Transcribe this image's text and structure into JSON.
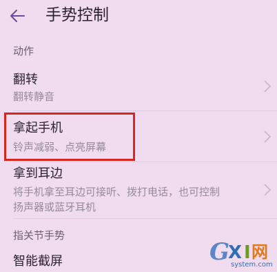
{
  "header": {
    "title": "手势控制",
    "back_icon": "back-arrow-icon"
  },
  "sections": [
    {
      "header": "动作"
    },
    {
      "header": "指关节手势"
    }
  ],
  "items": [
    {
      "title": "翻转",
      "subtitle": "翻转静音"
    },
    {
      "title": "拿起手机",
      "subtitle": "铃声减弱、点亮屏幕"
    },
    {
      "title": "拿到耳边",
      "subtitle_line1": "将手机拿至耳边可接听、拨打电话，也可控制",
      "subtitle_line2": "扬声器或蓝牙耳机"
    },
    {
      "title": "智能截屏"
    }
  ],
  "watermark": {
    "logo": "GXI网",
    "domain": "system.com"
  },
  "colors": {
    "background": "#f1dcef",
    "highlight": "#d9261c",
    "accent": "#6a4a9a"
  }
}
